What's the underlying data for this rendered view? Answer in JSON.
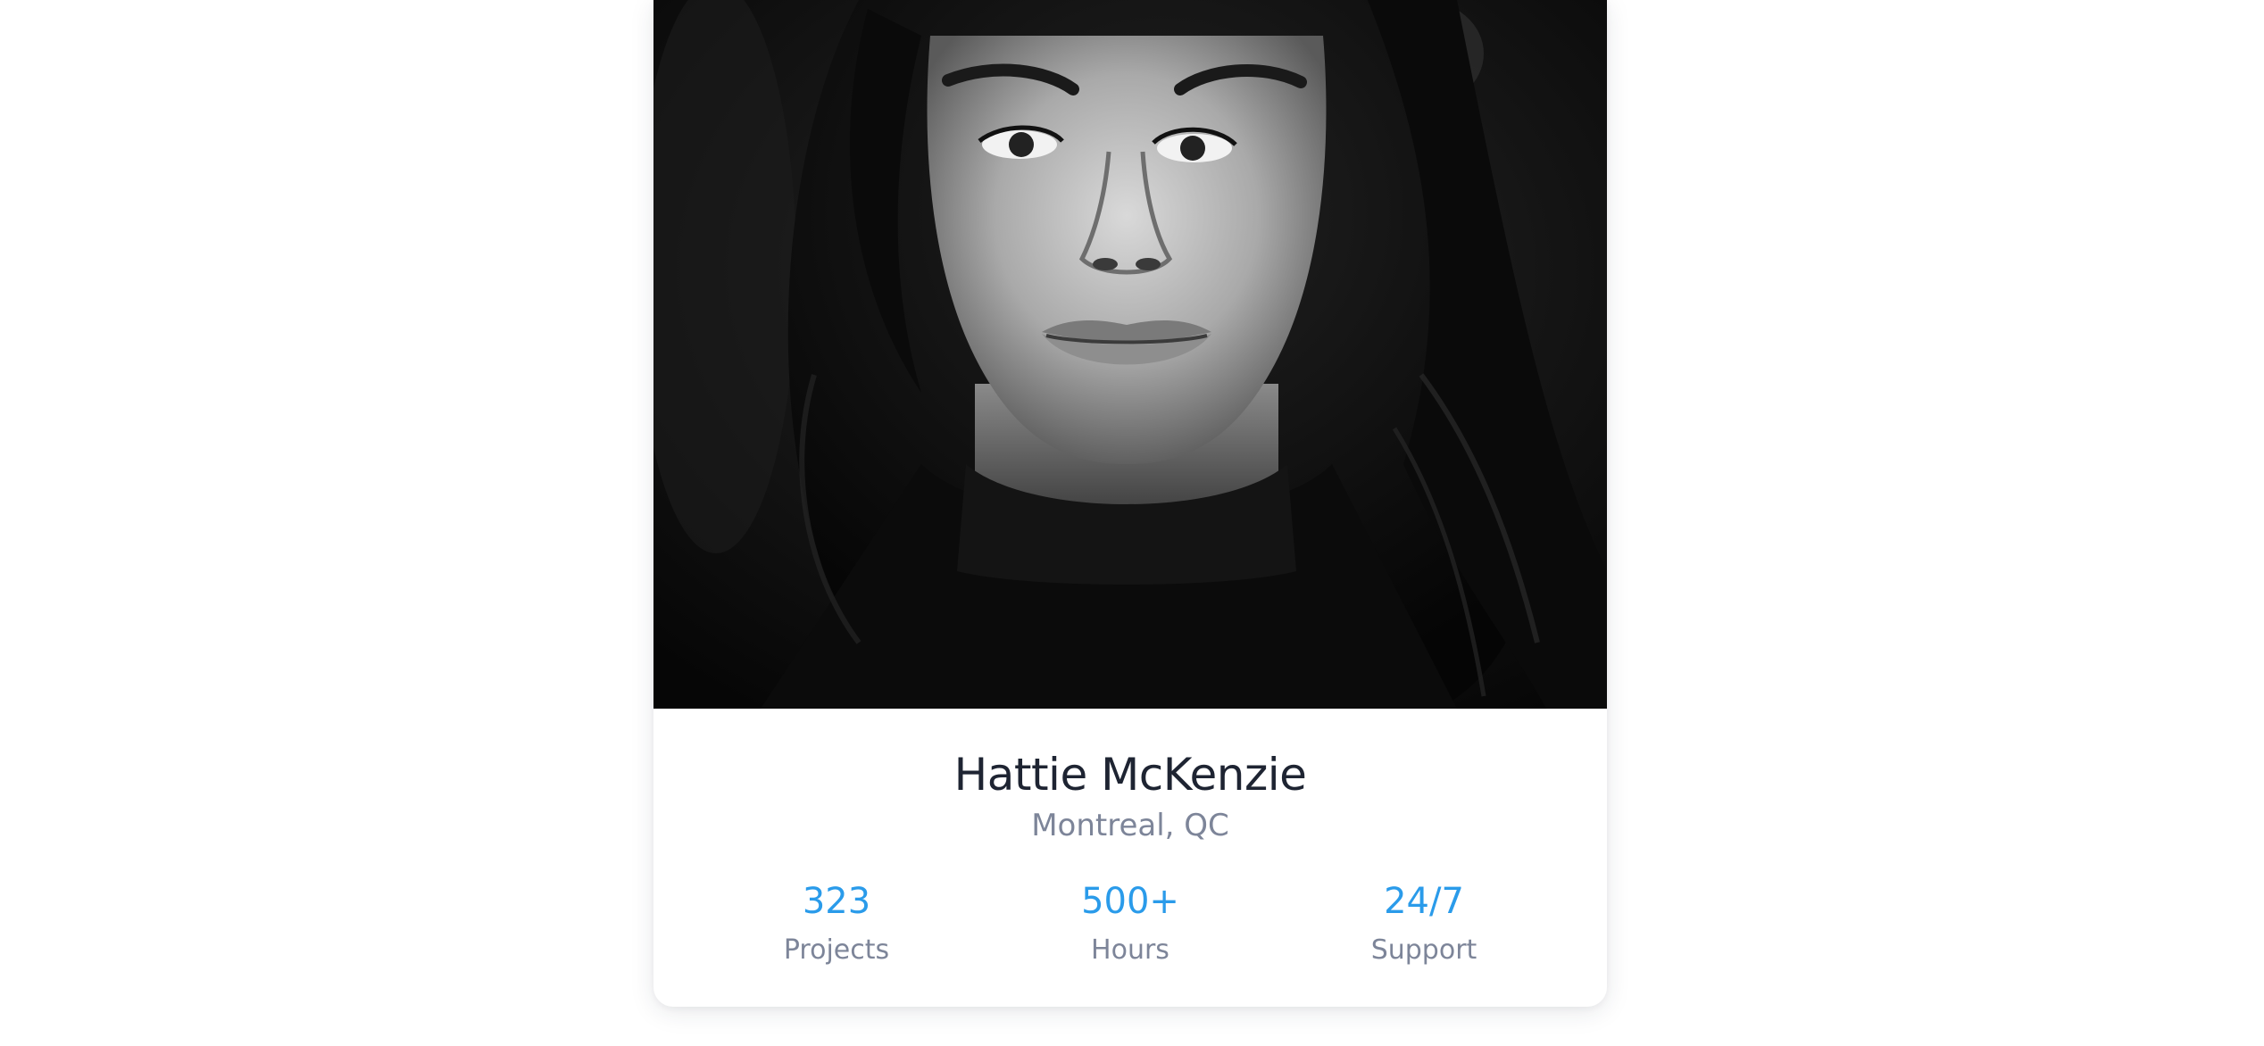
{
  "profile": {
    "name": "Hattie McKenzie",
    "location": "Montreal, QC",
    "photo_icon": "portrait-photo"
  },
  "stats": [
    {
      "value": "323",
      "label": "Projects"
    },
    {
      "value": "500+",
      "label": "Hours"
    },
    {
      "value": "24/7",
      "label": "Support"
    }
  ],
  "colors": {
    "accent": "#2a9bea",
    "name_text": "#1e2432",
    "muted_text": "#7d8599",
    "background": "#ffffff"
  }
}
